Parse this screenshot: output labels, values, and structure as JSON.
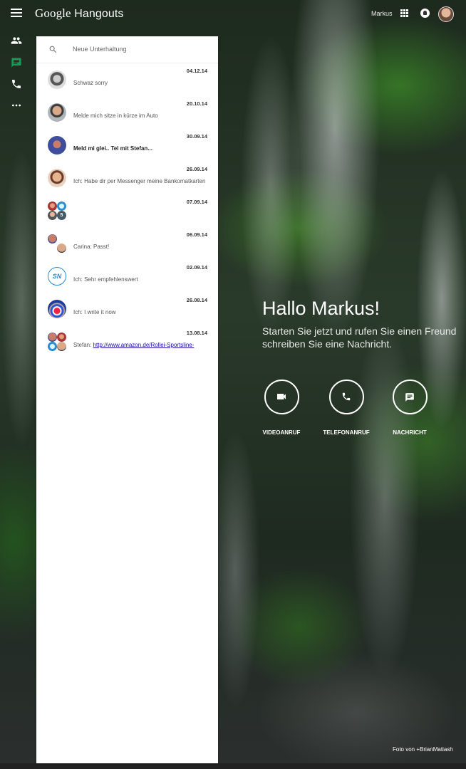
{
  "app": {
    "logo_google": "Google",
    "logo_product": "Hangouts"
  },
  "header": {
    "user_name": "Markus"
  },
  "search": {
    "placeholder": "Neue Unterhaltung"
  },
  "conversations": [
    {
      "date": "04.12.14",
      "preview": "Schwaz sorry",
      "unread": false
    },
    {
      "date": "20.10.14",
      "preview": "Melde mich sitze in kürze im Auto",
      "unread": false
    },
    {
      "date": "30.09.14",
      "preview": "Meld mi glei.. Tel mit Stefan...",
      "unread": true
    },
    {
      "date": "26.09.14",
      "preview": "Ich: Habe dir per Messenger meine Bankomatkarten PIN geschickt",
      "unread": false
    },
    {
      "date": "07.09.14",
      "preview": "",
      "unread": false,
      "group_count": "5"
    },
    {
      "date": "06.09.14",
      "preview": "Carina: Passt!",
      "unread": false
    },
    {
      "date": "02.09.14",
      "preview": "Ich: Sehr empfehlenswert",
      "unread": false
    },
    {
      "date": "26.08.14",
      "preview": "Ich: I write it now",
      "unread": false
    },
    {
      "date": "13.08.14",
      "preview_prefix": "Stefan: ",
      "preview_link": "http://www.amazon.de/Rollei-Sportsline-",
      "unread": false
    }
  ],
  "welcome": {
    "title": "Hallo Markus!",
    "line1": "Starten Sie jetzt und rufen Sie einen Freund",
    "line2": "schreiben Sie eine Nachricht."
  },
  "actions": {
    "video": "VIDEOANRUF",
    "phone": "TELEFONANRUF",
    "message": "NACHRICHT"
  },
  "photo_credit": "Foto von +BrianMatiash",
  "colors": {
    "accent_green": "#0f9d58",
    "link": "#1a0dab",
    "panel": "#ffffff"
  }
}
